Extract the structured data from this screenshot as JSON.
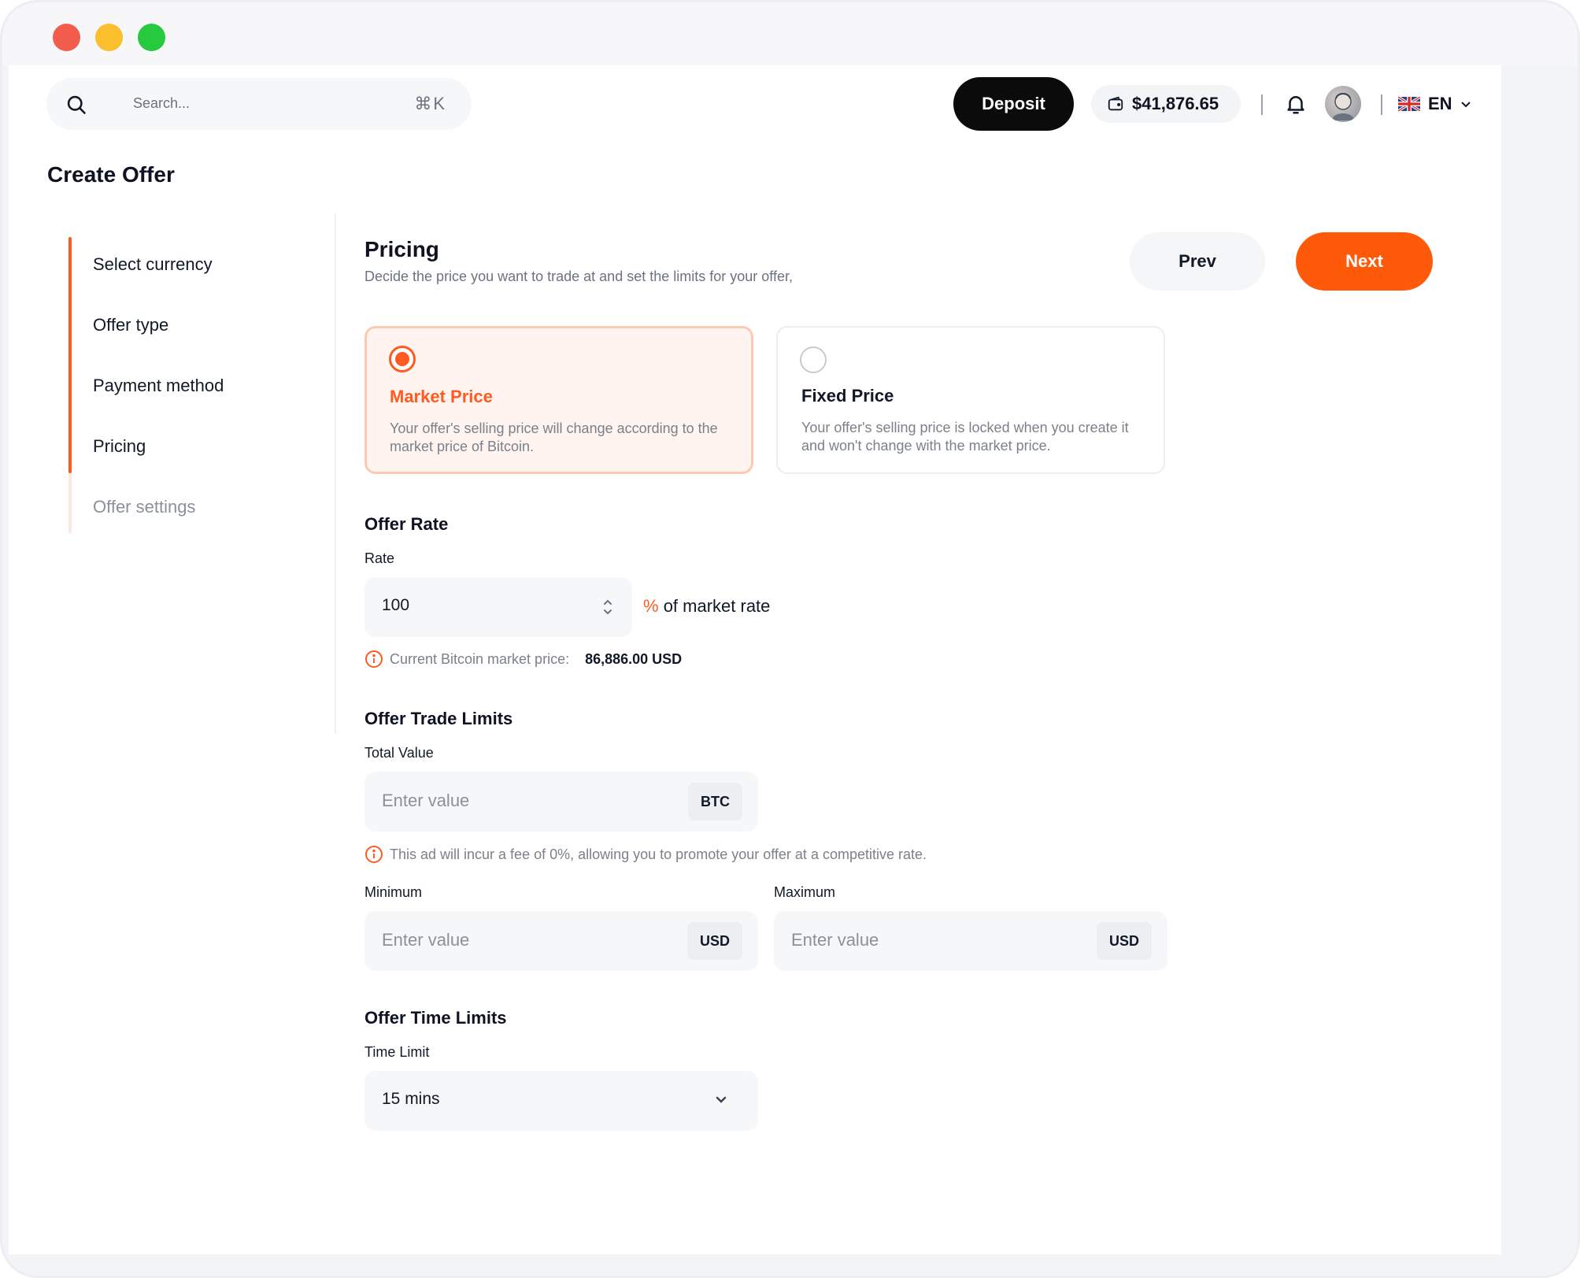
{
  "header": {
    "search_placeholder": "Search...",
    "search_shortcut": "⌘K",
    "deposit_label": "Deposit",
    "balance": "$41,876.65",
    "language": "EN"
  },
  "page_title": "Create Offer",
  "steps": [
    {
      "label": "Select currency"
    },
    {
      "label": "Offer type"
    },
    {
      "label": "Payment method"
    },
    {
      "label": "Pricing"
    },
    {
      "label": "Offer settings"
    }
  ],
  "pricing": {
    "title": "Pricing",
    "subtitle": "Decide the price you want to trade at and set the limits for your offer,",
    "prev_label": "Prev",
    "next_label": "Next",
    "options": [
      {
        "title": "Market Price",
        "description": "Your offer's selling price will change according to the market price of Bitcoin.",
        "selected": true
      },
      {
        "title": "Fixed Price",
        "description": "Your offer's selling price is locked when you create it and won't change with the market price.",
        "selected": false
      }
    ]
  },
  "offer_rate": {
    "title": "Offer Rate",
    "rate_label": "Rate",
    "rate_value": "100",
    "percent_symbol": "%",
    "rate_suffix": "of market rate",
    "market_price_label": "Current Bitcoin market price:",
    "market_price_value": "86,886.00 USD"
  },
  "trade_limits": {
    "title": "Offer Trade Limits",
    "total_label": "Total Value",
    "total_placeholder": "Enter value",
    "total_unit": "BTC",
    "fee_note": "This ad will incur a fee of 0%, allowing you to promote your offer at a competitive rate.",
    "min_label": "Minimum",
    "min_placeholder": "Enter value",
    "min_unit": "USD",
    "max_label": "Maximum",
    "max_placeholder": "Enter value",
    "max_unit": "USD"
  },
  "time_limits": {
    "title": "Offer Time Limits",
    "time_label": "Time Limit",
    "time_value": "15 mins"
  },
  "colors": {
    "accent": "#ff5a1f",
    "dark": "#0b0b0c"
  }
}
